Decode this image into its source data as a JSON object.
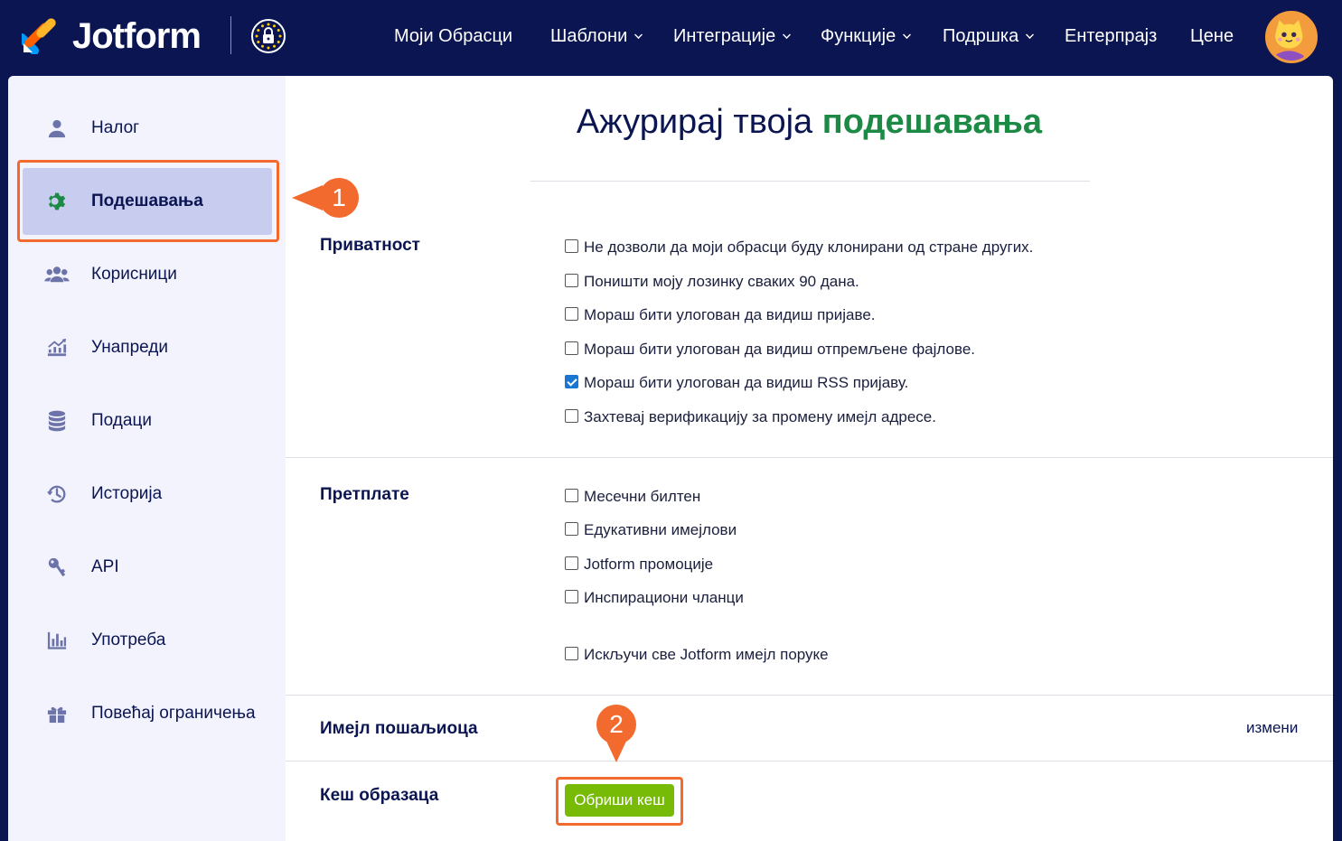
{
  "header": {
    "brand": "Jotform",
    "nav": [
      {
        "label": "Моји Обрасци",
        "dropdown": false
      },
      {
        "label": "Шаблони",
        "dropdown": true
      },
      {
        "label": "Интеграције",
        "dropdown": true
      },
      {
        "label": "Функције",
        "dropdown": true
      },
      {
        "label": "Подршка",
        "dropdown": true
      },
      {
        "label": "Ентерпрајз",
        "dropdown": false
      },
      {
        "label": "Цене",
        "dropdown": false
      }
    ]
  },
  "sidebar": {
    "items": [
      {
        "label": "Налог",
        "icon": "user-icon"
      },
      {
        "label": "Подешавања",
        "icon": "gear-icon",
        "active": true
      },
      {
        "label": "Корисници",
        "icon": "users-icon"
      },
      {
        "label": "Унапреди",
        "icon": "chart-up-icon"
      },
      {
        "label": "Подаци",
        "icon": "database-icon"
      },
      {
        "label": "Историја",
        "icon": "history-icon"
      },
      {
        "label": "API",
        "icon": "key-icon"
      },
      {
        "label": "Употреба",
        "icon": "bar-chart-icon"
      },
      {
        "label": "Повећај ограничења",
        "icon": "gift-icon"
      }
    ]
  },
  "main": {
    "title_prefix": "Ажурирај твоја",
    "title_accent": "подешавања",
    "privacy": {
      "title": "Приватност",
      "options": [
        {
          "label": "Не дозволи да моји обрасци буду клонирани од стране других.",
          "checked": false
        },
        {
          "label": "Поништи моју лозинку сваких 90 дана.",
          "checked": false
        },
        {
          "label": "Мораш бити улогован да видиш пријаве.",
          "checked": false
        },
        {
          "label": "Мораш бити улогован да видиш отпремљене фајлове.",
          "checked": false
        },
        {
          "label": "Мораш бити улогован да видиш RSS пријаву.",
          "checked": true
        },
        {
          "label": "Захтевај верификацију за промену имејл адресе.",
          "checked": false
        }
      ]
    },
    "subscriptions": {
      "title": "Претплате",
      "options": [
        {
          "label": "Месечни билтен",
          "checked": false
        },
        {
          "label": "Едукативни имејлови",
          "checked": false
        },
        {
          "label": "Jotform промоције",
          "checked": false
        },
        {
          "label": "Инспирациони чланци",
          "checked": false
        }
      ],
      "unsubscribe_all": {
        "label": "Искључи све Jotform имејл поруке",
        "checked": false
      }
    },
    "sender_email": {
      "title": "Имејл пошаљиоца",
      "edit_label": "измени"
    },
    "form_cache": {
      "title": "Кеш образаца",
      "button_label": "Обриши кеш"
    }
  },
  "callouts": [
    "1",
    "2"
  ],
  "colors": {
    "nav_bg": "#0a1551",
    "accent_green": "#1c8a45",
    "button_green": "#78bb07",
    "callout_orange": "#f26a2e"
  }
}
